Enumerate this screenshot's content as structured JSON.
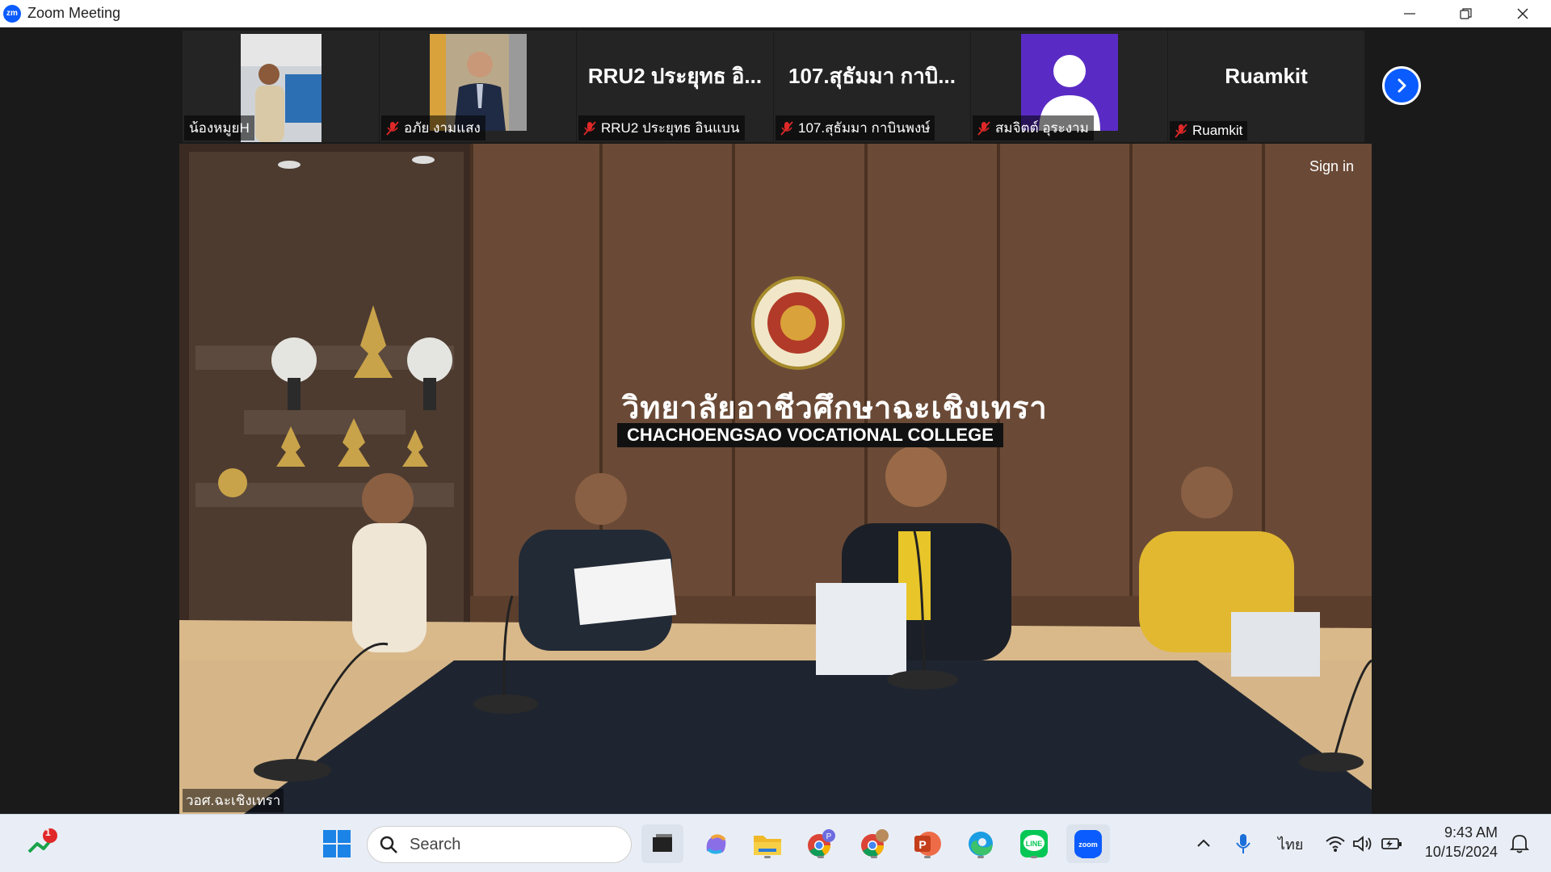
{
  "window": {
    "title": "Zoom Meeting",
    "logo_text": "zm"
  },
  "participants": [
    {
      "name": "น้องหมูยH",
      "muted": false,
      "display": "video"
    },
    {
      "name": "อภัย งามแสง",
      "muted": true,
      "display": "video"
    },
    {
      "name": "RRU2 ประยุทธ อินแบน",
      "muted": true,
      "display": "name",
      "big_label": "RRU2 ประยุทธ อิ..."
    },
    {
      "name": "107.สุธัมมา กาบินพงษ์",
      "muted": true,
      "display": "name",
      "big_label": "107.สุธัมมา กาบิ..."
    },
    {
      "name": "สมจิตต์ อุระงาม",
      "muted": true,
      "display": "avatar"
    },
    {
      "name": "Ruamkit",
      "muted": true,
      "display": "name",
      "big_label": "Ruamkit"
    }
  ],
  "main_video": {
    "speaker_name": "วอศ.ฉะเชิงเทรา",
    "sign_in_label": "Sign in",
    "wall_text_th": "วิทยาลัยอาชีวศึกษาฉะเชิงเทรา",
    "wall_text_en": "CHACHOENGSAO VOCATIONAL COLLEGE"
  },
  "taskbar": {
    "search_placeholder": "Search",
    "notification_badge": "1",
    "input_language": "ไทย",
    "time": "9:43 AM",
    "date": "10/15/2024"
  },
  "colors": {
    "zoom_blue": "#0b5cff",
    "mute_red": "#e02828",
    "avatar_purple": "#5a2bc4"
  }
}
